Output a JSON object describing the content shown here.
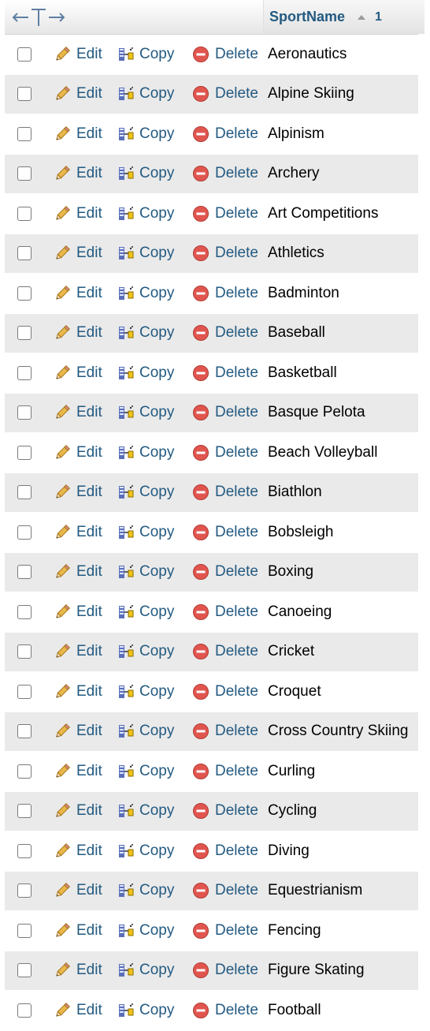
{
  "header": {
    "column_name": "SportName",
    "sort_order": "1"
  },
  "actions": {
    "edit_label": "Edit",
    "copy_label": "Copy",
    "delete_label": "Delete"
  },
  "colors": {
    "link": "#235a81",
    "row_alt": "#eaeaea",
    "delete_icon": "#e0564f",
    "pencil": "#e8b84a"
  },
  "rows": [
    "Aeronautics",
    "Alpine Skiing",
    "Alpinism",
    "Archery",
    "Art Competitions",
    "Athletics",
    "Badminton",
    "Baseball",
    "Basketball",
    "Basque Pelota",
    "Beach Volleyball",
    "Biathlon",
    "Bobsleigh",
    "Boxing",
    "Canoeing",
    "Cricket",
    "Croquet",
    "Cross Country Skiing",
    "Curling",
    "Cycling",
    "Diving",
    "Equestrianism",
    "Fencing",
    "Figure Skating",
    "Football"
  ]
}
